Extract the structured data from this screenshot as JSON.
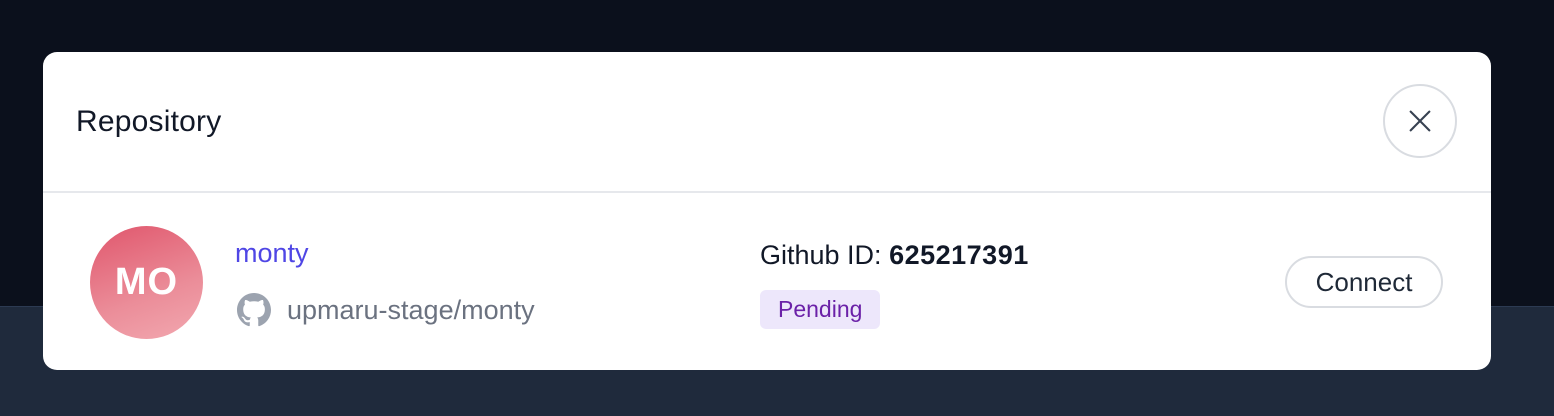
{
  "modal": {
    "title": "Repository",
    "close_icon": "close-icon"
  },
  "repository": {
    "avatar_initials": "MO",
    "name": "monty",
    "provider_icon": "github-icon",
    "full_path": "upmaru-stage/monty",
    "github_id_label": "Github ID:",
    "github_id_value": "625217391",
    "status": "Pending",
    "connect_label": "Connect"
  },
  "colors": {
    "link": "#4f46e5",
    "badge_bg": "#ede7fb",
    "badge_text": "#6b21a8",
    "avatar_start": "#e0566c",
    "avatar_end": "#f2a8b0"
  }
}
